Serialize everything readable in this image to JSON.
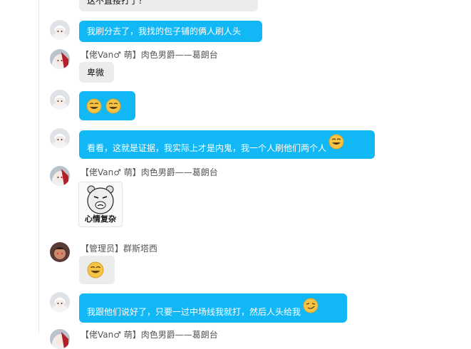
{
  "messages": [
    {
      "text": "这不直接打了？"
    },
    {
      "text": "我刷分去了，我找的包子铺的俩人刷人头"
    },
    {
      "sender": "【佬Van♂ 萌】肉色男爵——葛朗台",
      "text": "卑微"
    },
    {
      "emoji": "grin-emoji x2"
    },
    {
      "text": "看看，这就是证据，我实际上才是内鬼，我一个人刷他们两个人"
    },
    {
      "sender": "【佬Van♂ 萌】肉色男爵——葛朗台",
      "sticker_text": "心情复杂"
    },
    {
      "sender": "【管理员】群斯塔西",
      "emoji": "grin-emoji"
    },
    {
      "text": "我跟他们说好了，只要一过中场线我就打，然后人头给我"
    },
    {
      "sender": "【佬Van♂ 萌】肉色男爵——葛朗台"
    }
  ],
  "colors": {
    "self_bubble": "#12b7f5",
    "other_bubble": "#ececec",
    "emoji": "#f6c445"
  }
}
